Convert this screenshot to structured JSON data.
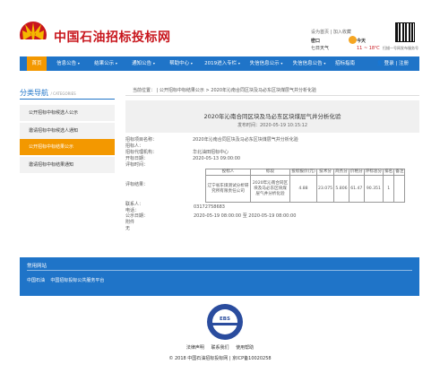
{
  "header": {
    "site_title": "中国石油招标投标网",
    "set_homepage": "设为首页",
    "add_favorite": "加入收藏",
    "city": "密口",
    "city_weather": "七日天气",
    "today": "今天",
    "temperature": "11 ~ 18℃",
    "qr_caption": "扫描一号网发布服务号",
    "colors": {
      "brand_red": "#c8161d",
      "logo_yellow": "#f5b800"
    }
  },
  "nav": {
    "items": [
      "首页",
      "信息公告",
      "结果公示",
      "通知公告",
      "帮助中心",
      "2019进入专栏",
      "失信信息公示",
      "失信信息公告",
      "招标指南"
    ],
    "login": "登录 | 注册",
    "colors": {
      "nav_bg": "#1f74c8",
      "active_bg": "#f39800"
    }
  },
  "sidebar": {
    "title": "分类导航",
    "title_en": "/ CATEGORIES",
    "items": [
      "公开招标中标候选人公示",
      "邀请招标中标候选人通知",
      "公开招标中标结果公示",
      "邀请招标中标结果通知"
    ]
  },
  "breadcrumb": {
    "label": "当前位置：",
    "parts": [
      "公开招标中标结果公示",
      "2020年沁南合同区块及马必东区块煤层气井分析化验"
    ]
  },
  "article": {
    "title": "2020年沁南合同区块及马必东区块煤层气井分析化验",
    "publish_time": "发布时间：2020-05-19 10:15:12",
    "fields": [
      {
        "label": "招标项目名称：",
        "value": "2020年沁南合同区块及马必东区块煤层气井分析化验"
      },
      {
        "label": "招标人：",
        "value": ""
      },
      {
        "label": "招标代理机构：",
        "value": "华北油田招标中心"
      },
      {
        "label": "开标日期：",
        "value": "2020-05-13 09:00:00"
      },
      {
        "label": "评标时间：",
        "value": ""
      }
    ],
    "result_label": "评标结果：",
    "table": {
      "headers": [
        "投标人",
        "标段",
        "投标报价(元)",
        "技术分",
        "商务分",
        "价格分",
        "评标总分",
        "排名",
        "备注"
      ],
      "rows": [
        [
          "辽宁省东煤测试分析研究所有限责任公司",
          "2020年沁南合同区块及马必东区块煤层气井分析化验",
          "4.88",
          "23.075",
          "5.806",
          "61.47",
          "90.351",
          "1",
          ""
        ]
      ]
    },
    "contact_label": "联系人：",
    "contact_value": "",
    "phone_label": "电话：",
    "phone_value": "03172758683",
    "period_label": "公示日期：",
    "period_value": "2020-05-19 08:00:00 至 2020-05-19 08:00:00",
    "attachment_label": "附件",
    "attachment_value": "无"
  },
  "footer": {
    "heading": "常用网站",
    "links": [
      "中国石油",
      "中国招标投标公共服务平台"
    ],
    "badge": "EBS",
    "bottom_links": [
      "法律声明",
      "联系我们",
      "使用帮助"
    ],
    "copyright": "© 2018 中国石油招标投标网 | 京ICP备10020258"
  }
}
